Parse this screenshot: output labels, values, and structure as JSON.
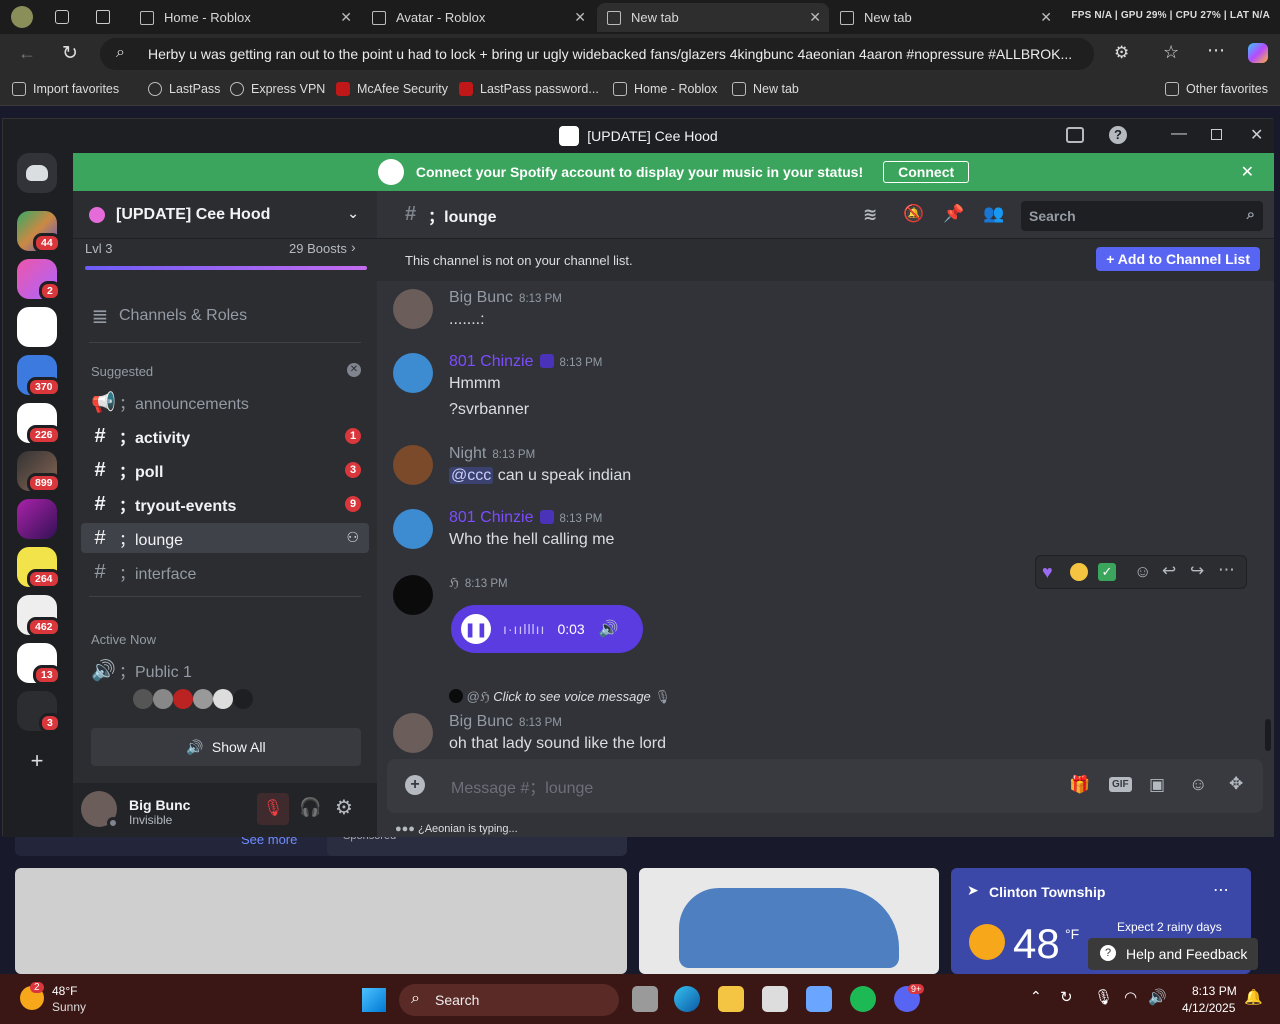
{
  "browser": {
    "tabs": [
      {
        "label": "Home - Roblox"
      },
      {
        "label": "Avatar - Roblox"
      },
      {
        "label": "New tab"
      },
      {
        "label": "New tab"
      }
    ],
    "perf": "FPS N/A  |  GPU 29%  |  CPU 27%  |  LAT N/A",
    "address": "Herby u was getting ran out to the point u had to lock + bring ur ugly widebacked fans/glazers 4kingbunc 4aeonian 4aaron #nopressure #ALLBROK...",
    "bookmarks": [
      "Import favorites",
      "LastPass",
      "Express VPN",
      "McAfee Security",
      "LastPass password...",
      "Home - Roblox",
      "New tab"
    ],
    "other_favorites": "Other favorites"
  },
  "discord": {
    "window_title": "[UPDATE] Cee Hood",
    "spotify_banner": "Connect your Spotify account to display your music in your status!",
    "connect_label": "Connect",
    "guild_badges": [
      "44",
      "2",
      "370",
      "226",
      "899",
      "264",
      "462",
      "13",
      "3"
    ],
    "server": {
      "name": "[UPDATE] Cee Hood",
      "level": "Lvl 3",
      "boosts": "29 Boosts",
      "channels_roles": "Channels & Roles",
      "suggested": "Suggested",
      "channels": [
        {
          "name": "；announcements",
          "count": ""
        },
        {
          "name": "；activity",
          "count": "1"
        },
        {
          "name": "；poll",
          "count": "3"
        },
        {
          "name": "；tryout-events",
          "count": "9"
        },
        {
          "name": "；lounge",
          "count": ""
        },
        {
          "name": "；interface",
          "count": ""
        }
      ],
      "active_now": "Active Now",
      "voice_channel": "；Public 1",
      "show_all": "Show All"
    },
    "user": {
      "name": "Big Bunc",
      "status": "Invisible"
    },
    "channel": {
      "name": "；lounge",
      "search_placeholder": "Search",
      "notice": "This channel is not on your channel list.",
      "add_button": "Add to Channel List"
    },
    "messages": [
      {
        "author": "Big Bunc",
        "time": "8:13 PM",
        "lines": [
          ".......:"
        ]
      },
      {
        "author": "801 Chinzie",
        "time": "8:13 PM",
        "lines": [
          "Hmmm",
          "?svrbanner"
        ]
      },
      {
        "author": "Night",
        "time": "8:13 PM",
        "mention": "@ccc",
        "lines": [
          "can u speak indian"
        ]
      },
      {
        "author": "801 Chinzie",
        "time": "8:13 PM",
        "lines": [
          "Who the hell calling me"
        ]
      },
      {
        "author": "ℌ",
        "time": "8:13 PM",
        "voice_duration": "0:03"
      },
      {
        "reply_to": "@ℌ",
        "reply_text": "Click to see voice message",
        "author": "Big Bunc",
        "time": "8:13 PM",
        "lines": [
          "oh that lady sound like the lord"
        ]
      }
    ],
    "composer_placeholder": "Message #；lounge",
    "typing": "¿Aeonian is typing..."
  },
  "background": {
    "see_more": "See more",
    "sponsored": "Sponsored",
    "weather_location": "Clinton Township",
    "weather_temp": "48",
    "weather_unit": "°F",
    "weather_note": "Expect 2 rainy days",
    "help": "Help and Feedback"
  },
  "taskbar": {
    "weather_temp": "48°F",
    "weather_cond": "Sunny",
    "weather_badge": "2",
    "search": "Search",
    "time": "8:13 PM",
    "date": "4/12/2025",
    "discord_badge": "9+"
  },
  "colors": {
    "spotify_green": "#3ba55d",
    "blurple": "#5865f2",
    "purple_user": "#7d4cff",
    "voice_purple": "#5b3ce0"
  }
}
